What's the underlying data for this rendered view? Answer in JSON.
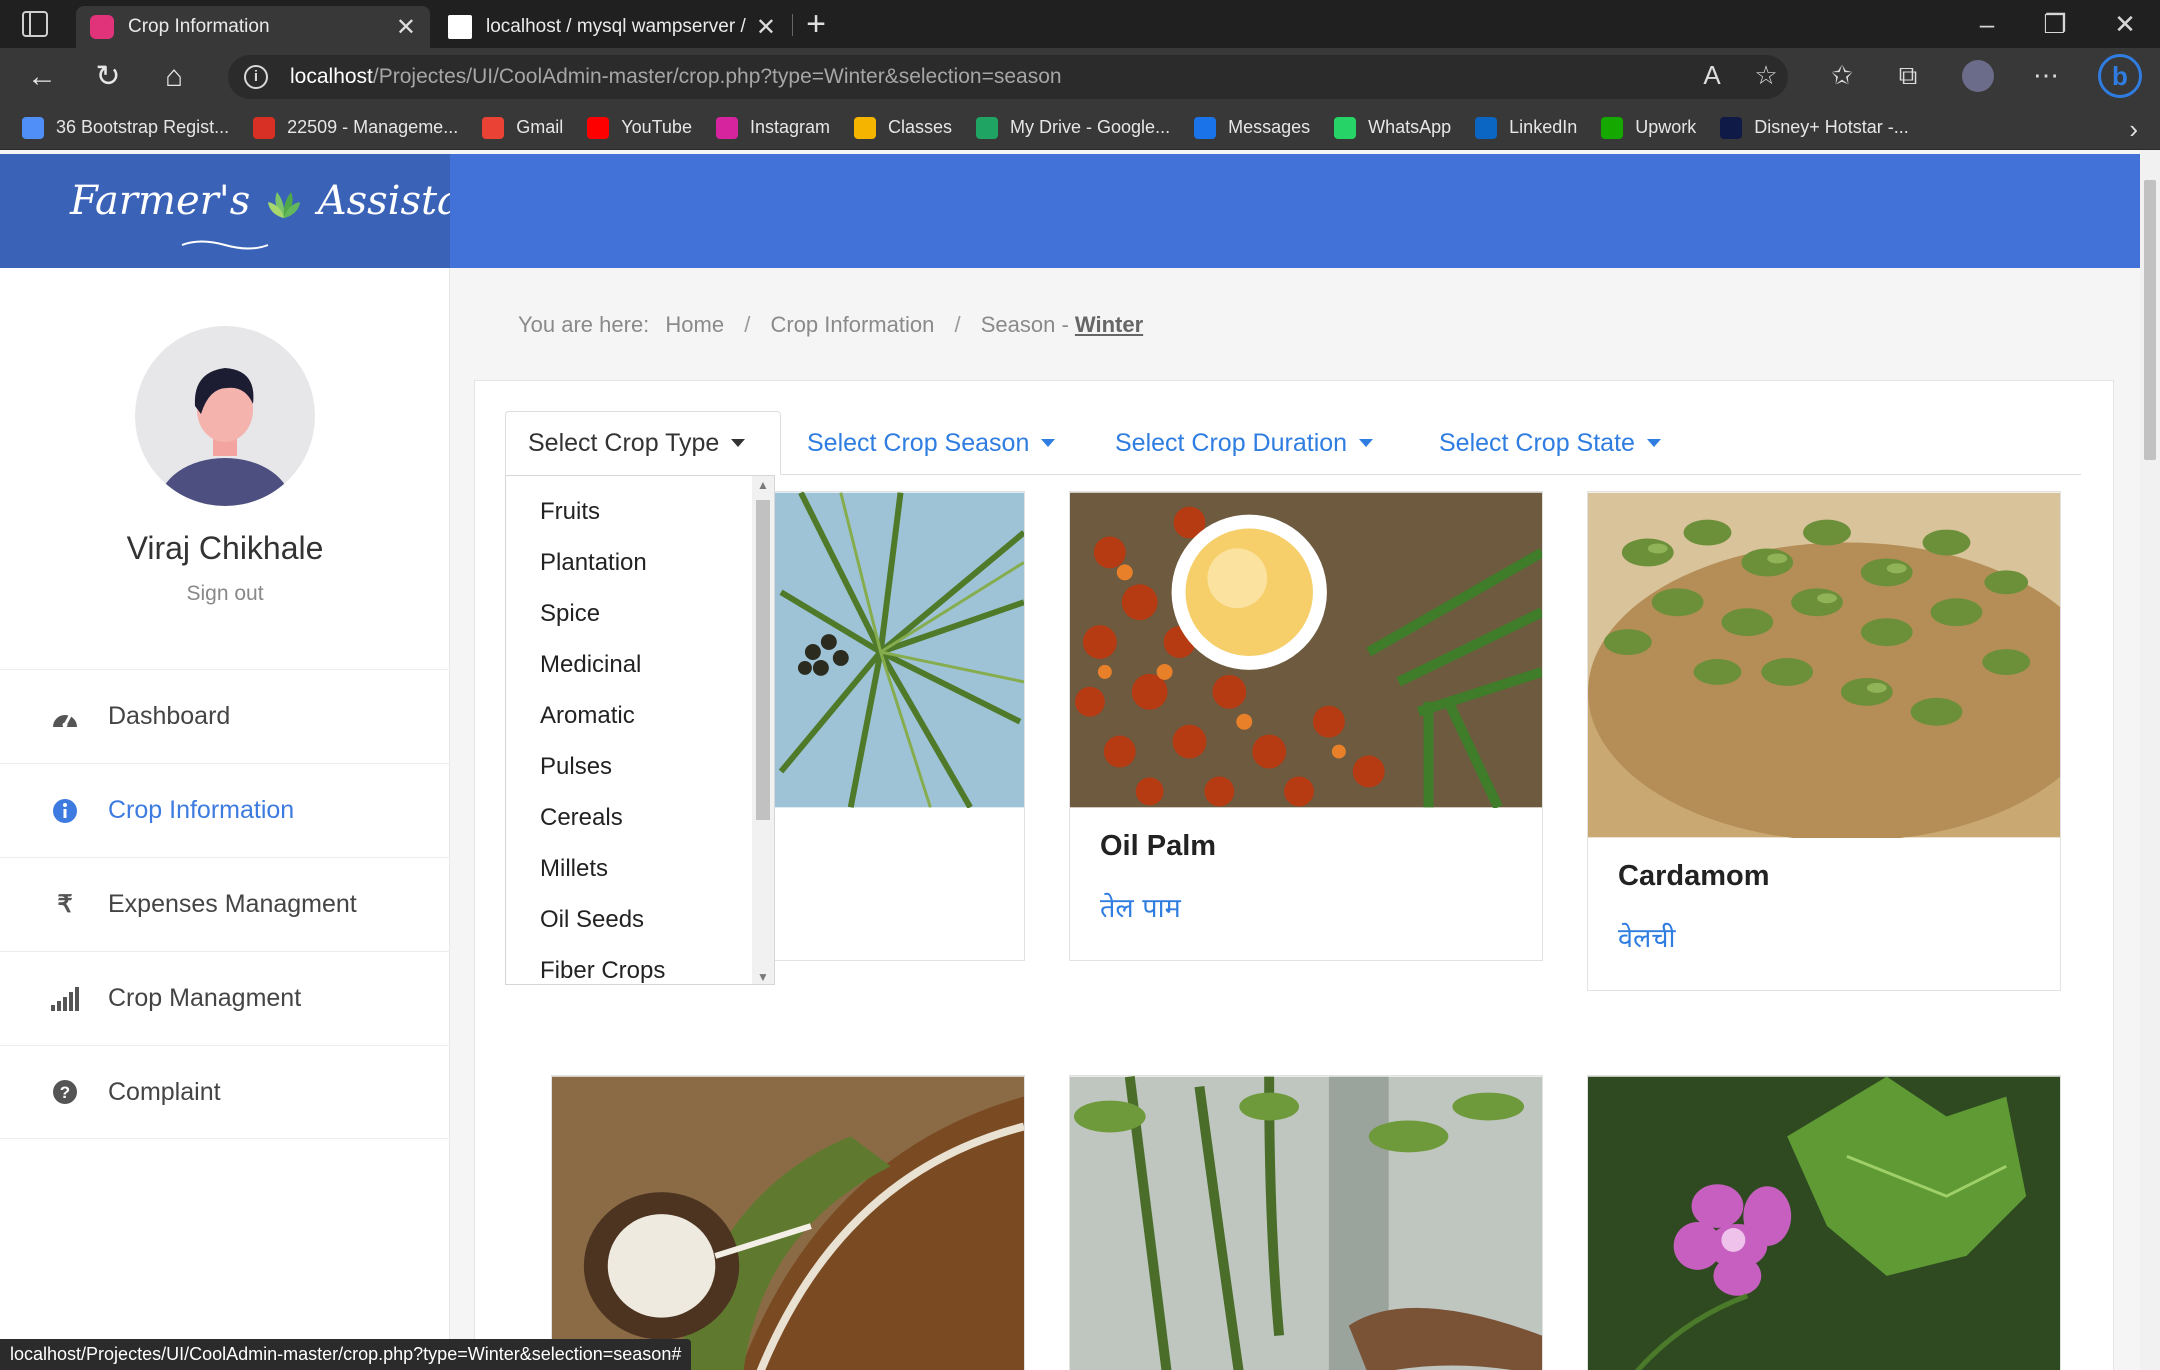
{
  "browser": {
    "tabs": [
      {
        "title": "Crop Information",
        "active": true
      },
      {
        "title": "localhost / mysql wampserver / f",
        "active": false
      }
    ],
    "url_host": "localhost",
    "url_path": "/Projectes/UI/CoolAdmin-master/crop.php?type=Winter&selection=season",
    "bookmarks": [
      {
        "label": "36 Bootstrap Regist...",
        "icon": "bootstrap-icon",
        "color": "#4f8ff7"
      },
      {
        "label": "22509 - Manageme...",
        "icon": "pdf-icon",
        "color": "#d93025"
      },
      {
        "label": "Gmail",
        "icon": "gmail-icon",
        "color": "#ea4335"
      },
      {
        "label": "YouTube",
        "icon": "youtube-icon",
        "color": "#ff0000"
      },
      {
        "label": "Instagram",
        "icon": "instagram-icon",
        "color": "#d6249f"
      },
      {
        "label": "Classes",
        "icon": "classroom-icon",
        "color": "#f4b400"
      },
      {
        "label": "My Drive - Google...",
        "icon": "drive-icon",
        "color": "#1fa463"
      },
      {
        "label": "Messages",
        "icon": "messages-icon",
        "color": "#1a73e8"
      },
      {
        "label": "WhatsApp",
        "icon": "whatsapp-icon",
        "color": "#25d366"
      },
      {
        "label": "LinkedIn",
        "icon": "linkedin-icon",
        "color": "#0a66c2"
      },
      {
        "label": "Upwork",
        "icon": "upwork-icon",
        "color": "#14a800"
      },
      {
        "label": "Disney+ Hotstar -...",
        "icon": "hotstar-icon",
        "color": "#0f1a47"
      }
    ],
    "status_url": "localhost/Projectes/UI/CoolAdmin-master/crop.php?type=Winter&selection=season#"
  },
  "app": {
    "brand_color": "#4272d7",
    "accent_color": "#2f7de0",
    "logo_text_left": "Farmer's",
    "logo_text_right": "Assistant"
  },
  "user": {
    "name": "Viraj Chikhale",
    "signout_label": "Sign out"
  },
  "sidebar": {
    "items": [
      {
        "label": "Dashboard",
        "icon": "dashboard-gauge-icon",
        "active": false
      },
      {
        "label": "Crop Information",
        "icon": "info-circle-icon",
        "active": true
      },
      {
        "label": "Expenses Managment",
        "icon": "rupee-icon",
        "active": false
      },
      {
        "label": "Crop Managment",
        "icon": "signal-bars-icon",
        "active": false
      },
      {
        "label": "Complaint",
        "icon": "question-circle-icon",
        "active": false
      }
    ]
  },
  "breadcrumb": {
    "prefix": "You are here:",
    "home": "Home",
    "crop_info": "Crop Information",
    "season_prefix": "Season -",
    "season": "Winter"
  },
  "filters": {
    "type": "Select Crop Type",
    "season": "Select Crop Season",
    "duration": "Select Crop Duration",
    "state": "Select Crop State"
  },
  "crop_type_options": [
    "Fruits",
    "Plantation",
    "Spice",
    "Medicinal",
    "Aromatic",
    "Pulses",
    "Cereals",
    "Millets",
    "Oil Seeds",
    "Fiber Crops"
  ],
  "crops": [
    {
      "name": "Oil Palm",
      "local_name": "तेल पाम"
    },
    {
      "name": "Cardamom",
      "local_name": "वेलची"
    }
  ]
}
